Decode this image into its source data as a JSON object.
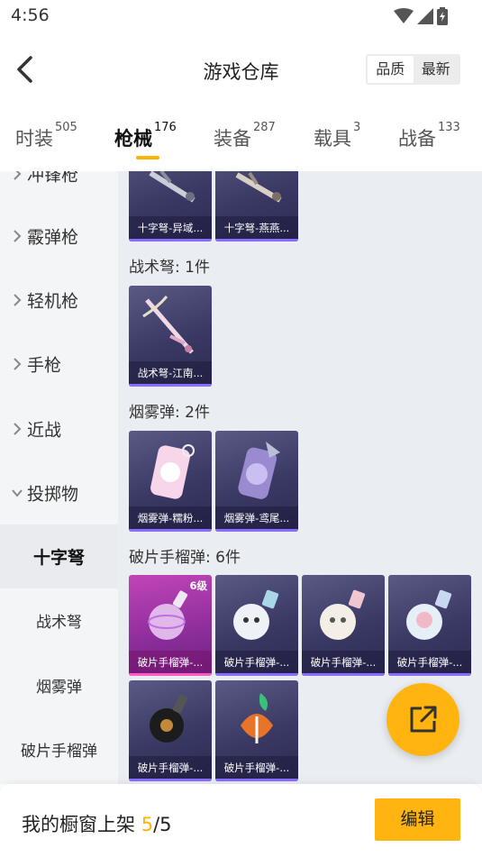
{
  "status": {
    "time": "4:56"
  },
  "header": {
    "title": "游戏仓库",
    "sort_options": [
      {
        "label": "品质"
      },
      {
        "label": "最新"
      }
    ]
  },
  "tabs": [
    {
      "label": "时装",
      "count": "505"
    },
    {
      "label": "枪械",
      "count": "176"
    },
    {
      "label": "装备",
      "count": "287"
    },
    {
      "label": "载具",
      "count": "3"
    },
    {
      "label": "战备",
      "count": "133"
    }
  ],
  "sidebar": {
    "categories": [
      {
        "label": "冲锋枪"
      },
      {
        "label": "霰弹枪"
      },
      {
        "label": "轻机枪"
      },
      {
        "label": "手枪"
      },
      {
        "label": "近战"
      },
      {
        "label": "投掷物"
      }
    ],
    "subcategories": [
      {
        "label": "十字弩"
      },
      {
        "label": "战术弩"
      },
      {
        "label": "烟雾弹"
      },
      {
        "label": "破片手榴弹"
      }
    ]
  },
  "content": {
    "top_items": [
      {
        "name": "十字弩-异域..."
      },
      {
        "name": "十字弩-燕燕..."
      }
    ],
    "sections": [
      {
        "title": "战术弩: 1件",
        "items": [
          {
            "name": "战术弩-江南..."
          }
        ]
      },
      {
        "title": "烟雾弹: 2件",
        "items": [
          {
            "name": "烟雾弹-糯粉..."
          },
          {
            "name": "烟雾弹-鸢尾..."
          }
        ]
      },
      {
        "title": "破片手榴弹: 6件",
        "items": [
          {
            "name": "破片手榴弹-...",
            "level": "6级"
          },
          {
            "name": "破片手榴弹-..."
          },
          {
            "name": "破片手榴弹-..."
          },
          {
            "name": "破片手榴弹-..."
          },
          {
            "name": "破片手榴弹-..."
          },
          {
            "name": "破片手榴弹-..."
          }
        ]
      }
    ]
  },
  "footer": {
    "label": "我的橱窗上架",
    "current": "5",
    "sep_total": "/5",
    "edit_label": "编辑"
  },
  "colors": {
    "accent": "#ffb400",
    "sidebar_bg": "#f4f5f7",
    "content_bg": "#eaedf1",
    "card_bg": "#3a3964"
  }
}
